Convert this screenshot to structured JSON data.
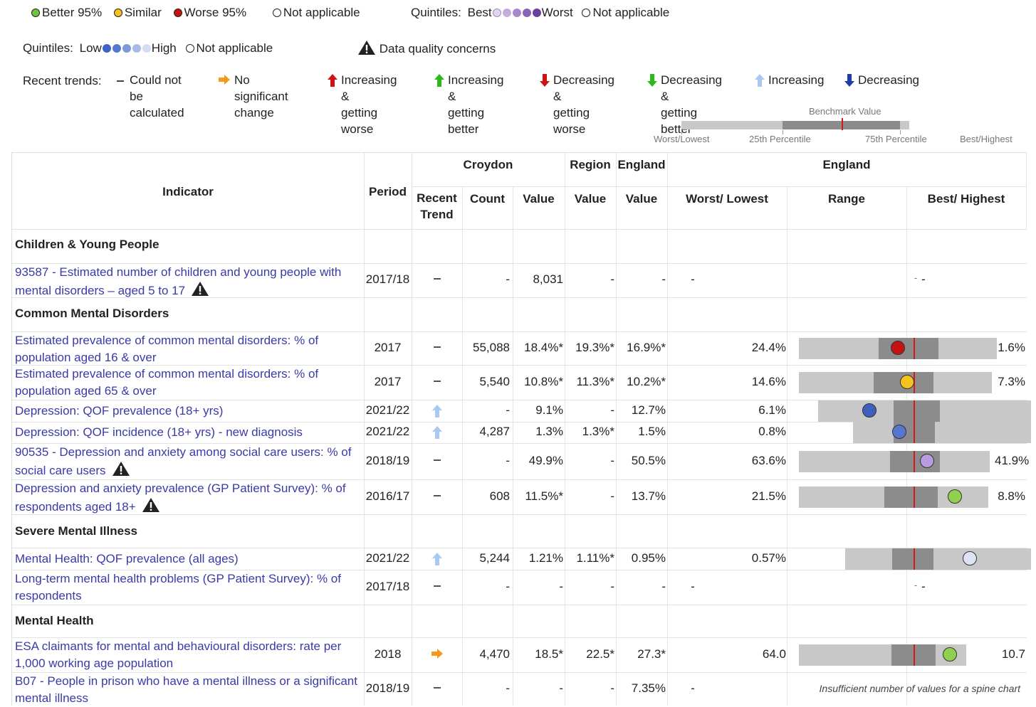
{
  "legend": {
    "compare": [
      {
        "label": "Better 95%",
        "color": "#6fc33b"
      },
      {
        "label": "Similar",
        "color": "#f6c21c"
      },
      {
        "label": "Worse 95%",
        "color": "#c61212"
      },
      {
        "label": "Not applicable",
        "color": "#ffffff"
      }
    ],
    "quintiles_a": {
      "label": "Quintiles:",
      "best": "Best",
      "worst": "Worst",
      "na": "Not applicable",
      "colors": [
        "#e2d6ef",
        "#c4add9",
        "#a888c9",
        "#8a62b7",
        "#6b3fa0"
      ]
    },
    "quintiles_b": {
      "label": "Quintiles:",
      "low": "Low",
      "high": "High",
      "na": "Not applicable",
      "colors": [
        "#3f63c7",
        "#5677cf",
        "#7d97d9",
        "#a8bbe5",
        "#d3ddf2"
      ]
    },
    "data_quality": "Data quality concerns",
    "trends_label": "Recent trends:",
    "trends": [
      {
        "icon": "dash-icon",
        "line1": "Could not be",
        "line2": "calculated"
      },
      {
        "icon": "orange-right-arrow-icon",
        "line1": "No significant",
        "line2": "change"
      },
      {
        "icon": "red-up-arrow-icon",
        "line1": "Increasing &",
        "line2": "getting worse"
      },
      {
        "icon": "green-up-arrow-icon",
        "line1": "Increasing &",
        "line2": "getting better"
      },
      {
        "icon": "red-down-arrow-icon",
        "line1": "Decreasing &",
        "line2": "getting worse"
      },
      {
        "icon": "green-down-arrow-icon",
        "line1": "Decreasing &",
        "line2": "getting better"
      },
      {
        "icon": "light-blue-up-arrow-icon",
        "line1": "Increasing",
        "line2": ""
      },
      {
        "icon": "dark-blue-down-arrow-icon",
        "line1": "Decreasing",
        "line2": ""
      }
    ],
    "benchmark": {
      "title": "Benchmark Value",
      "worst": "Worst/Lowest",
      "p25": "25th Percentile",
      "p75": "75th Percentile",
      "best": "Best/Highest"
    }
  },
  "table": {
    "headers": {
      "indicator": "Indicator",
      "period": "Period",
      "croydon": "Croydon",
      "region": "Region",
      "england": "England",
      "england_group": "England",
      "recent_trend": "Recent Trend",
      "count": "Count",
      "value": "Value",
      "region_value": "Value",
      "england_value": "Value",
      "worst": "Worst/ Lowest",
      "range": "Range",
      "best": "Best/ Highest"
    },
    "sections": [
      {
        "title": "Children & Young People"
      },
      {
        "title": "Common Mental Disorders"
      },
      {
        "title": "Severe Mental Illness"
      },
      {
        "title": "Mental Health"
      }
    ],
    "rows": [
      {
        "indicator": "93587 - Estimated number of children and young people with mental disorders – aged 5 to 17",
        "warn": true,
        "period": "2017/18",
        "trend": "dash",
        "count": "-",
        "value": "8,031",
        "region": "-",
        "england": "-",
        "worst": "-",
        "best": "-",
        "spine": null
      },
      {
        "indicator": "Estimated prevalence of common mental disorders: % of population aged 16 & over",
        "warn": false,
        "period": "2017",
        "trend": "dash",
        "count": "55,088",
        "value": "18.4%*",
        "region": "19.3%*",
        "england": "16.9%*",
        "worst": "24.4%",
        "best": "1.6%",
        "spine": {
          "marker": "#c61212"
        }
      },
      {
        "indicator": "Estimated prevalence of common mental disorders: % of population aged 65 & over",
        "warn": false,
        "period": "2017",
        "trend": "dash",
        "count": "5,540",
        "value": "10.8%*",
        "region": "11.3%*",
        "england": "10.2%*",
        "worst": "14.6%",
        "best": "7.3%",
        "spine": {
          "marker": "#f6c21c"
        }
      },
      {
        "indicator": "Depression: QOF prevalence (18+ yrs)",
        "warn": false,
        "period": "2021/22",
        "trend": "up-light",
        "count": "-",
        "value": "9.1%",
        "region": "-",
        "england": "12.7%",
        "worst": "6.1%",
        "best": "",
        "spine": {
          "marker": "#3f5fbf"
        }
      },
      {
        "indicator": "Depression: QOF incidence (18+ yrs) - new diagnosis",
        "warn": false,
        "period": "2021/22",
        "trend": "up-light",
        "count": "4,287",
        "value": "1.3%",
        "region": "1.3%*",
        "england": "1.5%",
        "worst": "0.8%",
        "best": "",
        "spine": {
          "marker": "#5677cf"
        }
      },
      {
        "indicator": "90535 - Depression and anxiety among social care users: % of social care users",
        "warn": true,
        "period": "2018/19",
        "trend": "dash",
        "count": "-",
        "value": "49.9%",
        "region": "-",
        "england": "50.5%",
        "worst": "63.6%",
        "best": "41.9%",
        "spine": {
          "marker": "#b99be0"
        }
      },
      {
        "indicator": "Depression and anxiety prevalence (GP Patient Survey): % of respondents aged 18+",
        "warn": true,
        "period": "2016/17",
        "trend": "dash",
        "count": "608",
        "value": "11.5%*",
        "region": "-",
        "england": "13.7%",
        "worst": "21.5%",
        "best": "8.8%",
        "spine": {
          "marker": "#8fd14f"
        }
      },
      {
        "indicator": "Mental Health: QOF prevalence (all ages)",
        "warn": false,
        "period": "2021/22",
        "trend": "up-light",
        "count": "5,244",
        "value": "1.21%",
        "region": "1.11%*",
        "england": "0.95%",
        "worst": "0.57%",
        "best": "",
        "spine": {
          "marker": "#dde3f3"
        }
      },
      {
        "indicator": "Long-term mental health problems (GP Patient Survey): % of respondents",
        "warn": false,
        "period": "2017/18",
        "trend": "dash",
        "count": "-",
        "value": "-",
        "region": "-",
        "england": "-",
        "worst": "-",
        "best": "-",
        "spine": null
      },
      {
        "indicator": "ESA claimants for mental and behavioural disorders: rate per 1,000 working age population",
        "warn": false,
        "period": "2018",
        "trend": "right-orange",
        "count": "4,470",
        "value": "18.5*",
        "region": "22.5*",
        "england": "27.3*",
        "worst": "64.0",
        "best": "10.7",
        "spine": {
          "marker": "#8fd14f"
        }
      },
      {
        "indicator": "B07 - People in prison who have a mental illness or a significant mental illness",
        "warn": false,
        "period": "2018/19",
        "trend": "dash",
        "count": "-",
        "value": "-",
        "region": "-",
        "england": "7.35%",
        "worst": "-",
        "best": "",
        "spine": null,
        "note": "Insufficient number of values for a spine chart"
      }
    ]
  }
}
